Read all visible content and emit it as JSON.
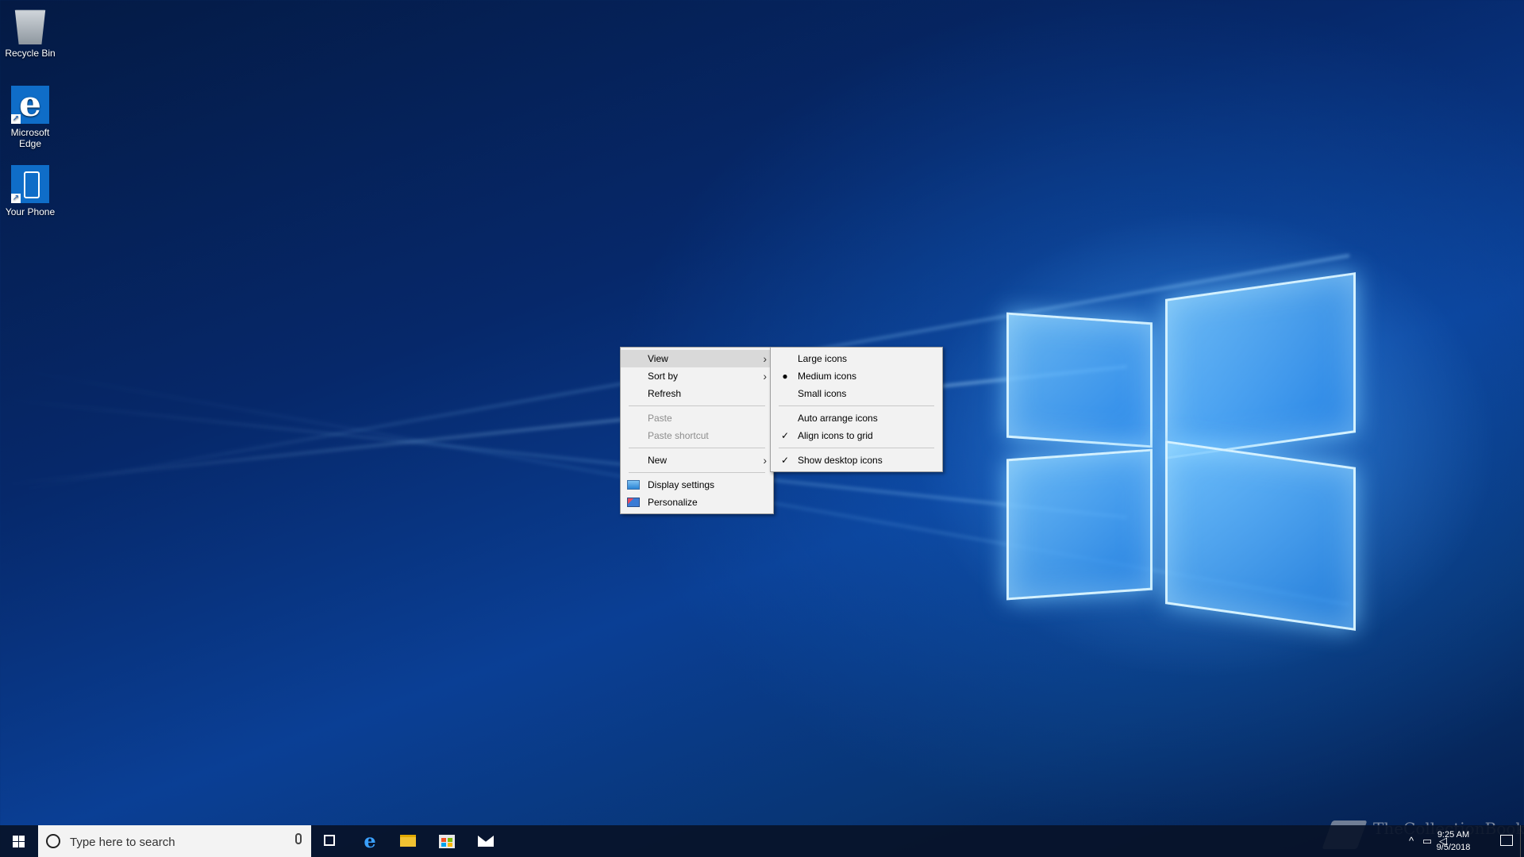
{
  "desktop": {
    "icons": [
      {
        "label": "Recycle Bin",
        "icon": "recycle-bin-icon"
      },
      {
        "label": "Microsoft Edge",
        "icon": "edge-icon"
      },
      {
        "label": "Your Phone",
        "icon": "phone-icon"
      }
    ]
  },
  "context_menu": {
    "items": [
      {
        "label": "View",
        "has_submenu": true,
        "highlighted": true
      },
      {
        "label": "Sort by",
        "has_submenu": true
      },
      {
        "label": "Refresh"
      },
      {
        "label": "Paste",
        "disabled": true
      },
      {
        "label": "Paste shortcut",
        "disabled": true
      },
      {
        "label": "New",
        "has_submenu": true
      },
      {
        "label": "Display settings",
        "icon": "display-settings-icon"
      },
      {
        "label": "Personalize",
        "icon": "personalize-icon"
      }
    ]
  },
  "view_submenu": {
    "items": [
      {
        "label": "Large icons"
      },
      {
        "label": "Medium icons",
        "selected": true
      },
      {
        "label": "Small icons"
      },
      {
        "label": "Auto arrange icons"
      },
      {
        "label": "Align icons to grid",
        "checked": true
      },
      {
        "label": "Show desktop icons",
        "checked": true
      }
    ]
  },
  "taskbar": {
    "search_placeholder": "Type here to search",
    "apps": [
      "task-view-icon",
      "edge-icon",
      "file-explorer-icon",
      "store-icon",
      "mail-icon"
    ],
    "clock_time": "9:25 AM",
    "clock_date": "9/5/2018"
  },
  "watermark": "TheCollectionBook",
  "colors": {
    "menu_bg": "#f2f2f2",
    "menu_highlight": "#d9d9d9",
    "taskbar_bg": "#08122a",
    "accent": "#0f6dc8"
  }
}
